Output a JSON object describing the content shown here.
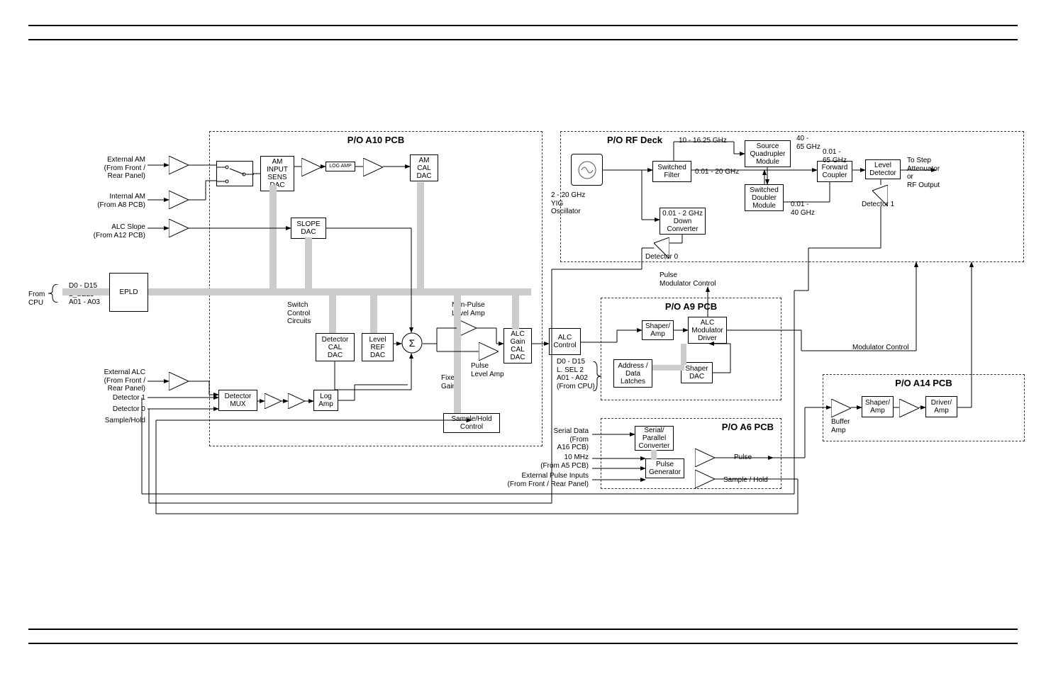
{
  "chart_data": {
    "type": "block-diagram",
    "groups": {
      "a10": "P/O A10 PCB",
      "rfdeck": "P/O RF Deck",
      "a9": "P/O A9 PCB",
      "a14": "P/O A14 PCB",
      "a6": "P/O A6 PCB"
    }
  },
  "labels": {
    "ext_am": "External AM\n(From Front /\nRear Panel)",
    "int_am": "Internal AM\n(From A8 PCB)",
    "alc_slope": "ALC Slope\n(From A12 PCB)",
    "from_cpu": "From\nCPU",
    "cpu_lines": "D0 - D15\nL_SEL3\nA01 - A03",
    "ext_alc": "External ALC\n(From Front /\nRear Panel)",
    "det1": "Detector 1",
    "det0": "Detector 0",
    "sh": "Sample/Hold",
    "serial_data": "Serial Data\n(From\nA16 PCB)",
    "mhz10": "10 MHz\n(From A5 PCB)",
    "ext_pulse": "External Pulse Inputs\n(From Front / Rear Panel)",
    "pulse_mod_ctrl": "Pulse\nModulator Control",
    "mod_ctrl": "Modulator Control",
    "pulse": "Pulse",
    "sample_hold": "Sample / Hold",
    "d0d15": "D0 - D15\nL. SEL 2\nA01 - A02\n(From CPU)",
    "nonpulse": "Non-Pulse\nLevel Amp",
    "pulseamp": "Pulse\nLevel Amp",
    "fixed_gain": "Fixed\nGain",
    "freq_10_16": "10 - 16.25 GHz",
    "freq_001_20": "0.01 - 20 GHz",
    "freq_40_65": "40 -\n65 GHz",
    "freq_001_65": "0.01 -\n65 GHz",
    "freq_001_40": "0.01 -\n40 GHz",
    "to_step": "To Step\nAttenuator\nor\nRF Output",
    "rf_det1": "Detector 1",
    "rf_det0": "Detector 0"
  },
  "boxes": {
    "am_dac": "AM\nINPUT\nSENS\nDAC",
    "log_amp": "LOG AMP",
    "am_cal": "AM\nCAL\nDAC",
    "slope_dac": "SLOPE\nDAC",
    "epld": "EPLD",
    "switch_ctrl": "Switch\nControl\nCircuits",
    "det_cal": "Detector\nCAL\nDAC",
    "lev_ref": "Level\nREF\nDAC",
    "det_mux": "Detector\nMUX",
    "log_amp2": "Log\nAmp",
    "alc_gain": "ALC\nGain\nCAL\nDAC",
    "sh_ctrl": "Sample/Hold\nControl",
    "alc_ctrl": "ALC\nControl",
    "shaper_amp": "Shaper/\nAmp",
    "alc_mod": "ALC\nModulator\nDriver",
    "addr_latch": "Address /\nData\nLatches",
    "shaper_dac": "Shaper\nDAC",
    "serial_par": "Serial/\nParallel\nConverter",
    "pulse_gen": "Pulse\nGenerator",
    "buf_amp": "Buffer\nAmp",
    "shaper_amp2": "Shaper/\nAmp",
    "driver_amp": "Driver/\nAmp",
    "yig": "2 - 20 GHz\nYIG\nOscillator",
    "sw_filter": "Switched\nFilter",
    "down_conv": "0.01 - 2 GHz\nDown\nConverter",
    "src_quad": "Source\nQuadrupler\nModule",
    "sw_doubler": "Switched\nDoubler\nModule",
    "fwd_coupler": "Forward\nCoupler",
    "lev_det": "Level\nDetector"
  }
}
